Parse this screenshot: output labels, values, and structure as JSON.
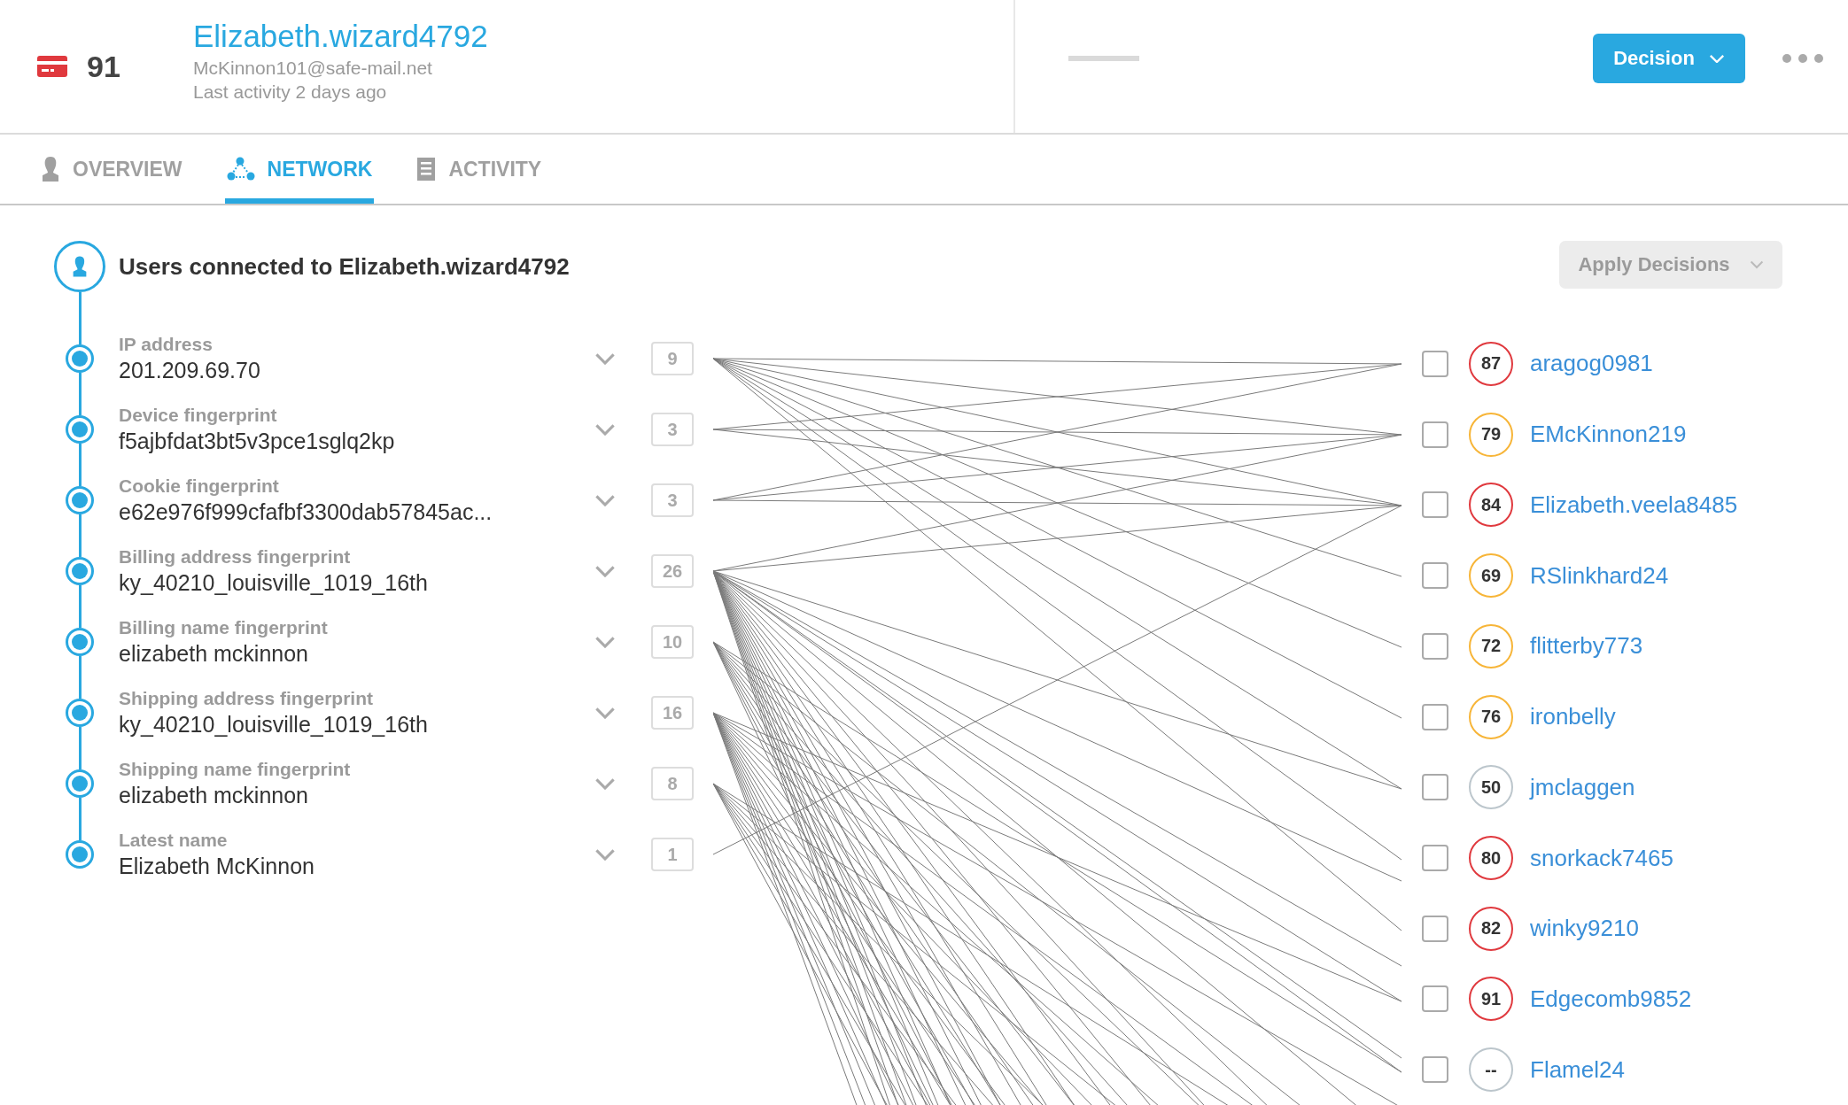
{
  "header": {
    "score": "91",
    "username": "Elizabeth.wizard4792",
    "email": "McKinnon101@safe-mail.net",
    "last_activity": "Last activity 2 days ago",
    "decision_button": "Decision"
  },
  "tabs": [
    {
      "label": "OVERVIEW",
      "selected": false,
      "kind": "person"
    },
    {
      "label": "NETWORK",
      "selected": true,
      "kind": "network"
    },
    {
      "label": "ACTIVITY",
      "selected": false,
      "kind": "document"
    }
  ],
  "network": {
    "title": "Users connected to Elizabeth.wizard4792",
    "apply_button": {
      "label": "Apply Decisions",
      "disabled": true
    },
    "attributes": [
      {
        "label": "IP address",
        "value": "201.209.69.70",
        "count": "9"
      },
      {
        "label": "Device fingerprint",
        "value": "f5ajbfdat3bt5v3pce1sglq2kp",
        "count": "3"
      },
      {
        "label": "Cookie fingerprint",
        "value": "e62e976f999cfafbf3300dab57845ac...",
        "count": "3"
      },
      {
        "label": "Billing address fingerprint",
        "value": "ky_40210_louisville_1019_16th",
        "count": "26"
      },
      {
        "label": "Billing name fingerprint",
        "value": "elizabeth mckinnon",
        "count": "10"
      },
      {
        "label": "Shipping address fingerprint",
        "value": "ky_40210_louisville_1019_16th",
        "count": "16"
      },
      {
        "label": "Shipping name fingerprint",
        "value": "elizabeth mckinnon",
        "count": "8"
      },
      {
        "label": "Latest name",
        "value": "Elizabeth McKinnon",
        "count": "1"
      }
    ],
    "users": [
      {
        "name": "aragog0981",
        "score": "87",
        "color": "#e0393e",
        "checked": false
      },
      {
        "name": "EMcKinnon219",
        "score": "79",
        "color": "#f7b538",
        "checked": false
      },
      {
        "name": "Elizabeth.veela8485",
        "score": "84",
        "color": "#e0393e",
        "checked": false
      },
      {
        "name": "RSlinkhard24",
        "score": "69",
        "color": "#f7b538",
        "checked": false
      },
      {
        "name": "flitterby773",
        "score": "72",
        "color": "#f7b538",
        "checked": false
      },
      {
        "name": "ironbelly",
        "score": "76",
        "color": "#f7b538",
        "checked": false
      },
      {
        "name": "jmclaggen",
        "score": "50",
        "color": "#bcc6cc",
        "checked": false
      },
      {
        "name": "snorkack7465",
        "score": "80",
        "color": "#e0393e",
        "checked": false
      },
      {
        "name": "winky9210",
        "score": "82",
        "color": "#e0393e",
        "checked": false
      },
      {
        "name": "Edgecomb9852",
        "score": "91",
        "color": "#e0393e",
        "checked": false
      },
      {
        "name": "Flamel24",
        "score": "--",
        "color": "#bcc6cc",
        "checked": false
      }
    ]
  }
}
